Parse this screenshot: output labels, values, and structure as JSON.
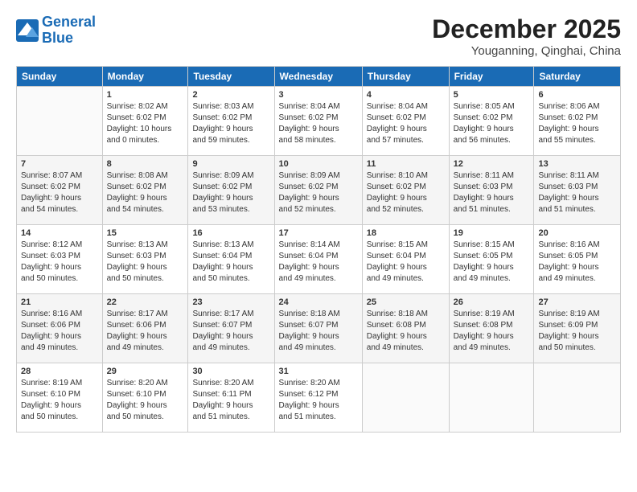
{
  "logo": {
    "line1": "General",
    "line2": "Blue"
  },
  "header": {
    "month": "December 2025",
    "location": "Youganning, Qinghai, China"
  },
  "weekdays": [
    "Sunday",
    "Monday",
    "Tuesday",
    "Wednesday",
    "Thursday",
    "Friday",
    "Saturday"
  ],
  "weeks": [
    [
      {
        "day": "",
        "info": ""
      },
      {
        "day": "1",
        "info": "Sunrise: 8:02 AM\nSunset: 6:02 PM\nDaylight: 10 hours\nand 0 minutes."
      },
      {
        "day": "2",
        "info": "Sunrise: 8:03 AM\nSunset: 6:02 PM\nDaylight: 9 hours\nand 59 minutes."
      },
      {
        "day": "3",
        "info": "Sunrise: 8:04 AM\nSunset: 6:02 PM\nDaylight: 9 hours\nand 58 minutes."
      },
      {
        "day": "4",
        "info": "Sunrise: 8:04 AM\nSunset: 6:02 PM\nDaylight: 9 hours\nand 57 minutes."
      },
      {
        "day": "5",
        "info": "Sunrise: 8:05 AM\nSunset: 6:02 PM\nDaylight: 9 hours\nand 56 minutes."
      },
      {
        "day": "6",
        "info": "Sunrise: 8:06 AM\nSunset: 6:02 PM\nDaylight: 9 hours\nand 55 minutes."
      }
    ],
    [
      {
        "day": "7",
        "info": "Sunrise: 8:07 AM\nSunset: 6:02 PM\nDaylight: 9 hours\nand 54 minutes."
      },
      {
        "day": "8",
        "info": "Sunrise: 8:08 AM\nSunset: 6:02 PM\nDaylight: 9 hours\nand 54 minutes."
      },
      {
        "day": "9",
        "info": "Sunrise: 8:09 AM\nSunset: 6:02 PM\nDaylight: 9 hours\nand 53 minutes."
      },
      {
        "day": "10",
        "info": "Sunrise: 8:09 AM\nSunset: 6:02 PM\nDaylight: 9 hours\nand 52 minutes."
      },
      {
        "day": "11",
        "info": "Sunrise: 8:10 AM\nSunset: 6:02 PM\nDaylight: 9 hours\nand 52 minutes."
      },
      {
        "day": "12",
        "info": "Sunrise: 8:11 AM\nSunset: 6:03 PM\nDaylight: 9 hours\nand 51 minutes."
      },
      {
        "day": "13",
        "info": "Sunrise: 8:11 AM\nSunset: 6:03 PM\nDaylight: 9 hours\nand 51 minutes."
      }
    ],
    [
      {
        "day": "14",
        "info": "Sunrise: 8:12 AM\nSunset: 6:03 PM\nDaylight: 9 hours\nand 50 minutes."
      },
      {
        "day": "15",
        "info": "Sunrise: 8:13 AM\nSunset: 6:03 PM\nDaylight: 9 hours\nand 50 minutes."
      },
      {
        "day": "16",
        "info": "Sunrise: 8:13 AM\nSunset: 6:04 PM\nDaylight: 9 hours\nand 50 minutes."
      },
      {
        "day": "17",
        "info": "Sunrise: 8:14 AM\nSunset: 6:04 PM\nDaylight: 9 hours\nand 49 minutes."
      },
      {
        "day": "18",
        "info": "Sunrise: 8:15 AM\nSunset: 6:04 PM\nDaylight: 9 hours\nand 49 minutes."
      },
      {
        "day": "19",
        "info": "Sunrise: 8:15 AM\nSunset: 6:05 PM\nDaylight: 9 hours\nand 49 minutes."
      },
      {
        "day": "20",
        "info": "Sunrise: 8:16 AM\nSunset: 6:05 PM\nDaylight: 9 hours\nand 49 minutes."
      }
    ],
    [
      {
        "day": "21",
        "info": "Sunrise: 8:16 AM\nSunset: 6:06 PM\nDaylight: 9 hours\nand 49 minutes."
      },
      {
        "day": "22",
        "info": "Sunrise: 8:17 AM\nSunset: 6:06 PM\nDaylight: 9 hours\nand 49 minutes."
      },
      {
        "day": "23",
        "info": "Sunrise: 8:17 AM\nSunset: 6:07 PM\nDaylight: 9 hours\nand 49 minutes."
      },
      {
        "day": "24",
        "info": "Sunrise: 8:18 AM\nSunset: 6:07 PM\nDaylight: 9 hours\nand 49 minutes."
      },
      {
        "day": "25",
        "info": "Sunrise: 8:18 AM\nSunset: 6:08 PM\nDaylight: 9 hours\nand 49 minutes."
      },
      {
        "day": "26",
        "info": "Sunrise: 8:19 AM\nSunset: 6:08 PM\nDaylight: 9 hours\nand 49 minutes."
      },
      {
        "day": "27",
        "info": "Sunrise: 8:19 AM\nSunset: 6:09 PM\nDaylight: 9 hours\nand 50 minutes."
      }
    ],
    [
      {
        "day": "28",
        "info": "Sunrise: 8:19 AM\nSunset: 6:10 PM\nDaylight: 9 hours\nand 50 minutes."
      },
      {
        "day": "29",
        "info": "Sunrise: 8:20 AM\nSunset: 6:10 PM\nDaylight: 9 hours\nand 50 minutes."
      },
      {
        "day": "30",
        "info": "Sunrise: 8:20 AM\nSunset: 6:11 PM\nDaylight: 9 hours\nand 51 minutes."
      },
      {
        "day": "31",
        "info": "Sunrise: 8:20 AM\nSunset: 6:12 PM\nDaylight: 9 hours\nand 51 minutes."
      },
      {
        "day": "",
        "info": ""
      },
      {
        "day": "",
        "info": ""
      },
      {
        "day": "",
        "info": ""
      }
    ]
  ]
}
